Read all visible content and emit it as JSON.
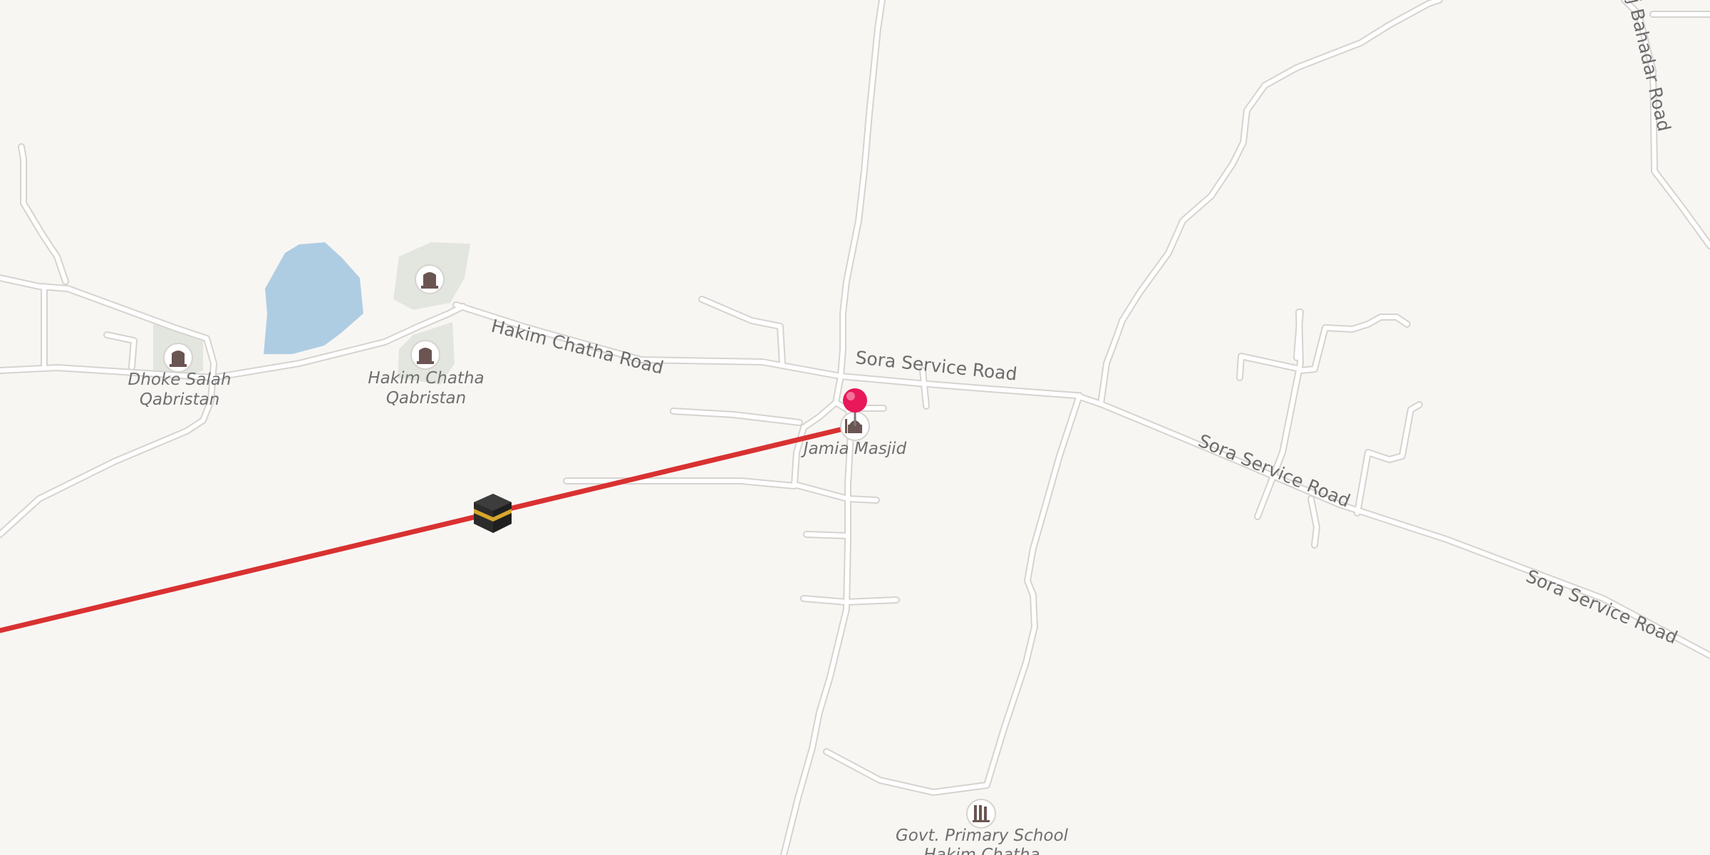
{
  "map": {
    "roads": {
      "hakim_chatha": "Hakim Chatha Road",
      "sora_service_1": "Sora Service Road",
      "sora_service_2": "Sora Service Road",
      "sora_service_3": "Sora Service Road",
      "bahadar_partial": "j Bahadar Road"
    },
    "pois": {
      "dhoke_salah_line1": "Dhoke Salah",
      "dhoke_salah_line2": "Qabristan",
      "hakim_chatha_q_line1": "Hakim Chatha",
      "hakim_chatha_q_line2": "Qabristan",
      "jamia_masjid": "Jamia Masjid",
      "school_line1": "Govt. Primary School",
      "school_line2": "Hakim Chatha"
    },
    "icons": {
      "cemetery": "cemetery-icon",
      "mosque": "mosque-icon",
      "school": "school-icon",
      "kaaba": "kaaba-icon",
      "pin": "location-pin-icon"
    },
    "colors": {
      "background": "#f8f6f3",
      "water": "#aecde3",
      "cemetery_area": "#e3e5df",
      "qibla_line": "#d93131",
      "pin": "#e8185a"
    }
  }
}
